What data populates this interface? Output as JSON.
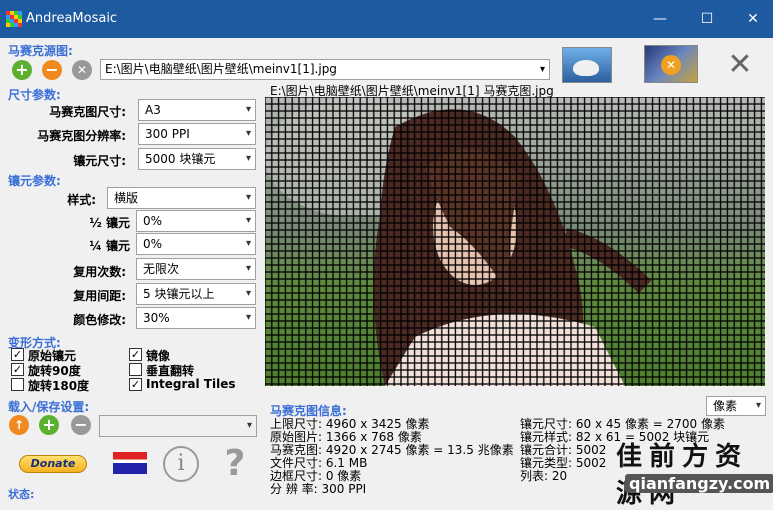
{
  "window": {
    "title": "AndreaMosaic",
    "minimize": "—",
    "maximize": "☐",
    "close": "✕"
  },
  "source": {
    "label": "马赛克源图:",
    "path": "E:\\图片\\电脑壁纸\\图片壁纸\\meinv1[1].jpg",
    "buttons": {
      "add": "+",
      "remove": "−",
      "clear": "✕"
    }
  },
  "size_params": {
    "label": "尺寸参数:",
    "rows": [
      {
        "label": "马赛克图尺寸:",
        "value": "A3"
      },
      {
        "label": "马赛克图分辨率:",
        "value": "300 PPI"
      },
      {
        "label": "镶元尺寸:",
        "value": "5000 块镶元"
      }
    ]
  },
  "tile_params": {
    "label": "镶元参数:",
    "rows": [
      {
        "label": "样式:",
        "value": "横版"
      },
      {
        "label": "½ 镶元",
        "value": "0%"
      },
      {
        "label": "¼ 镶元",
        "value": "0%"
      },
      {
        "label": "复用次数:",
        "value": "无限次"
      },
      {
        "label": "复用间距:",
        "value": "5 块镶元以上"
      },
      {
        "label": "颜色修改:",
        "value": "30%"
      }
    ]
  },
  "transform": {
    "label": "变形方式:",
    "items": [
      {
        "label": "原始镶元",
        "checked": true
      },
      {
        "label": "镜像",
        "checked": true
      },
      {
        "label": "旋转90度",
        "checked": true
      },
      {
        "label": "垂直翻转",
        "checked": false
      },
      {
        "label": "旋转180度",
        "checked": false
      },
      {
        "label": "Integral Tiles",
        "checked": true
      }
    ]
  },
  "load_save": {
    "label": "载入/保存设置:"
  },
  "bottom": {
    "donate": "Donate",
    "info": "i",
    "help": "?",
    "status": "状态:"
  },
  "preview": {
    "caption": "E:\\图片\\电脑壁纸\\图片壁纸\\meinv1[1] 马赛克图.jpg"
  },
  "info": {
    "label": "马赛克图信息:",
    "unit": "像素",
    "left": [
      "上限尺寸: 4960 x 3425 像素",
      "原始图片: 1366 x 768 像素",
      "马赛克图: 4920 x 2745 像素 = 13.5 兆像素",
      "文件尺寸: 6.1 MB",
      "边框尺寸: 0 像素",
      "分 辨 率: 300 PPI"
    ],
    "right": [
      "镶元尺寸: 60 x 45 像素 = 2700 像素",
      "镶元样式: 82 x 61 = 5002 块镶元",
      "镶元合计: 5002",
      "镶元类型: 5002",
      "列表: 20"
    ]
  },
  "watermark": {
    "line1": "佳 前 方 资 源 网",
    "line2": "qianfangzy.com"
  },
  "colors": {
    "accent": "#3a6fd6",
    "titlebar": "#1e5aa0",
    "add_green": "#5cb030",
    "remove_orange": "#f08a20"
  }
}
